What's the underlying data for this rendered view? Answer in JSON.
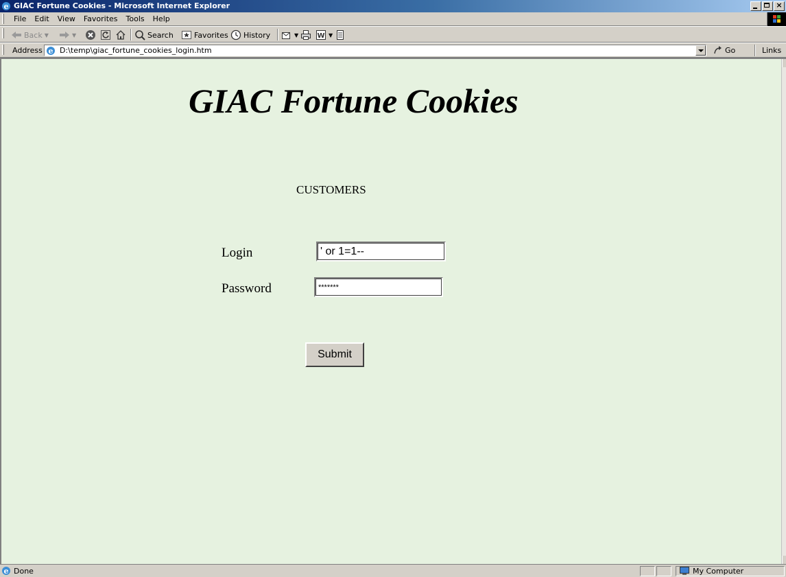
{
  "window": {
    "title": "GIAC Fortune Cookies - Microsoft Internet Explorer",
    "controls": [
      "minimize",
      "maximize",
      "close"
    ]
  },
  "menubar": {
    "items": [
      {
        "label": "File"
      },
      {
        "label": "Edit"
      },
      {
        "label": "View"
      },
      {
        "label": "Favorites"
      },
      {
        "label": "Tools"
      },
      {
        "label": "Help"
      }
    ]
  },
  "toolbar": {
    "back_label": "Back",
    "search_label": "Search",
    "favorites_label": "Favorites",
    "history_label": "History",
    "icons": [
      "back-arrow-icon",
      "forward-arrow-icon",
      "stop-icon",
      "refresh-icon",
      "home-icon",
      "search-icon",
      "favorites-icon",
      "history-icon",
      "mail-icon",
      "print-icon",
      "word-icon",
      "discuss-icon"
    ]
  },
  "addressbar": {
    "label": "Address",
    "url": "D:\\temp\\giac_fortune_cookies_login.htm",
    "go_label": "Go",
    "links_label": "Links"
  },
  "page": {
    "heading": "GIAC Fortune Cookies",
    "section_label": "CUSTOMERS",
    "background_color": "#e6f2e0",
    "login_label": "Login",
    "login_value": "' or 1=1--",
    "password_label": "Password",
    "password_value": "*******",
    "submit_label": "Submit"
  },
  "statusbar": {
    "status_text": "Done",
    "zone_text": "My Computer"
  }
}
